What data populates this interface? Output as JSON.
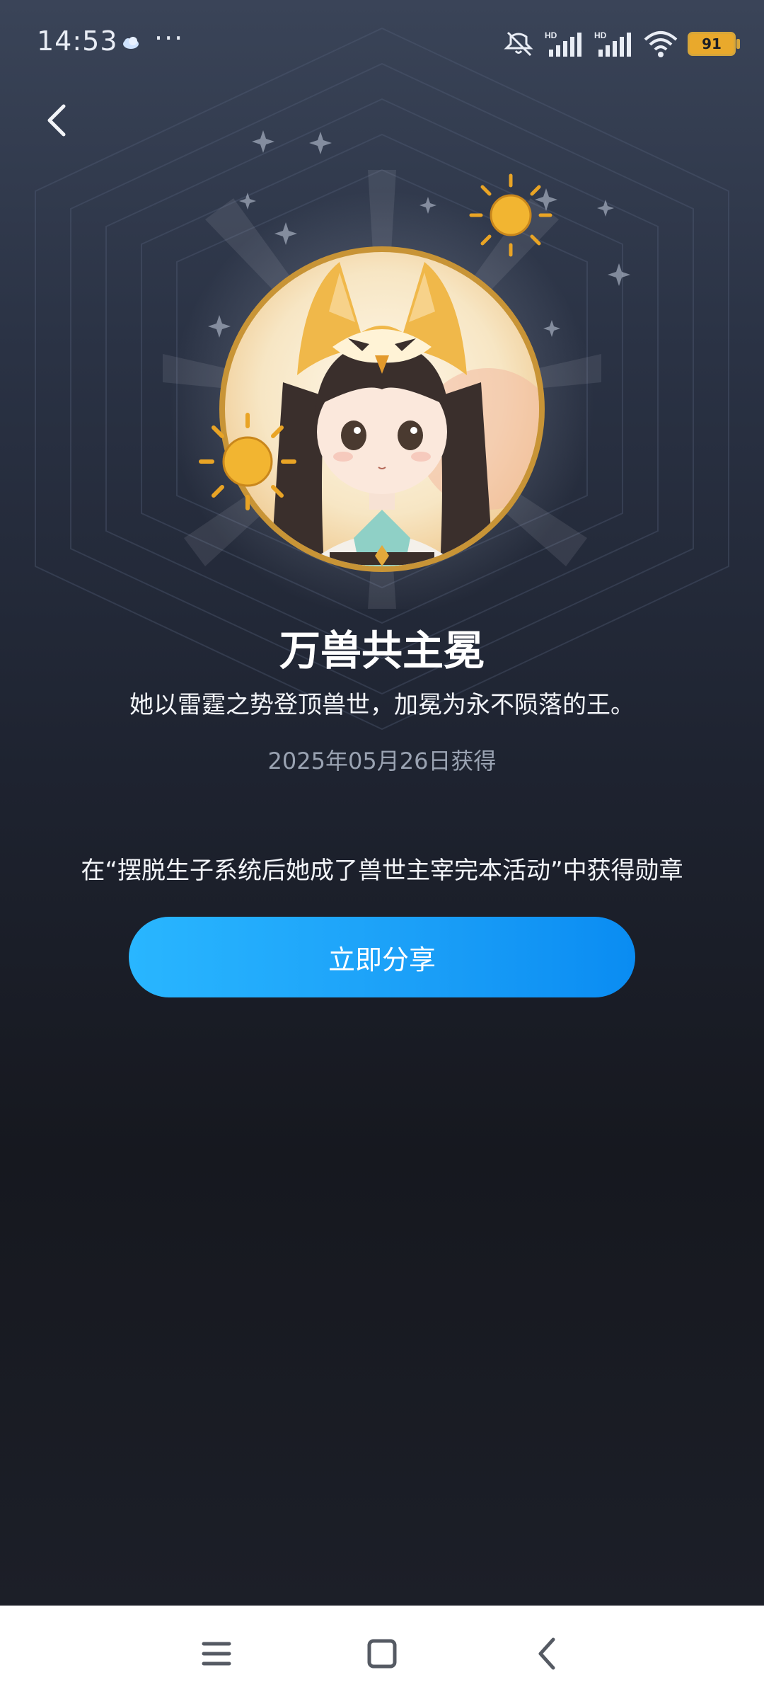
{
  "status_bar": {
    "time": "14:53",
    "more": "···",
    "battery": "91",
    "icons": [
      "weather-cloud-icon",
      "mute-icon",
      "signal-hd-icon",
      "signal-hd-icon",
      "wifi-icon",
      "battery-icon"
    ]
  },
  "medal": {
    "title": "万兽共主冕",
    "description": "她以雷霆之势登顶兽世，加冕为永不陨落的王。",
    "date": "2025年05月26日获得",
    "source": "在“摆脱生子系统后她成了兽世主宰完本活动”中获得勋章"
  },
  "actions": {
    "share_label": "立即分享"
  },
  "nav_bar": {
    "icons": [
      "menu-icon",
      "home-icon",
      "back-icon"
    ]
  },
  "colors": {
    "accent": "#1a9ef7",
    "badge_gold": "#e8b54a",
    "background": "#1e2330"
  }
}
